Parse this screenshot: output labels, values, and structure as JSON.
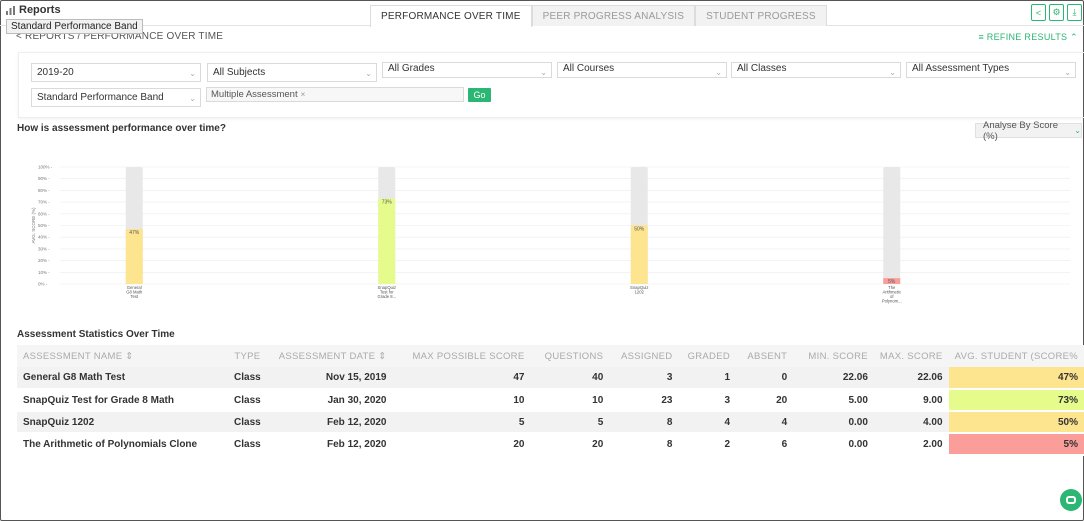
{
  "header": {
    "app_title": "Reports",
    "tooltip": "Standard Performance Band",
    "tabs": [
      "PERFORMANCE OVER TIME",
      "PEER PROGRESS ANALYSIS",
      "STUDENT PROGRESS"
    ],
    "buttons": [
      "share-icon",
      "settings-icon",
      "download-icon"
    ]
  },
  "breadcrumb": "< REPORTS / PERFORMANCE OVER TIME",
  "refine_label": "≡ REFINE RESULTS ⌃",
  "filters": {
    "year": "2019-20",
    "subject": "All Subjects",
    "grades": "All Grades",
    "courses": "All Courses",
    "classes": "All Classes",
    "assessment_types": "All Assessment Types",
    "band": "Standard Performance Band",
    "assessment_tag": "Multiple Assessment",
    "go_label": "Go"
  },
  "chart_question": "How is assessment performance over time?",
  "analyse_by": "Analyse By Score (%)",
  "chart_data": {
    "type": "bar",
    "ylabel": "AVG. SCORE (%)",
    "ylim": [
      0,
      100
    ],
    "yticks": [
      "100% -",
      "90% -",
      "80% -",
      "70% -",
      "60% -",
      "50% -",
      "40% -",
      "30% -",
      "20% -",
      "10% -",
      "0% -"
    ],
    "categories": [
      [
        "General",
        "G8 Math",
        "Test"
      ],
      [
        "SnapQuiz",
        "Test for",
        "Grade 8..."
      ],
      [
        "SnapQuiz",
        "1202"
      ],
      [
        "The",
        "Arithmetic",
        "of",
        "Polynom..."
      ]
    ],
    "values": [
      47,
      73,
      50,
      5
    ],
    "value_labels": [
      "47%",
      "73%",
      "50%",
      "5%"
    ],
    "bar_colors": [
      "#fde48f",
      "#e5fb8b",
      "#fde48f",
      "#fb9e9a"
    ],
    "track_color": "#e8e8e8",
    "grid": true
  },
  "stats": {
    "title": "Assessment Statistics Over Time",
    "columns": [
      "ASSESSMENT NAME ⇕",
      "TYPE",
      "ASSESSMENT DATE ⇕",
      "MAX POSSIBLE SCORE",
      "QUESTIONS",
      "ASSIGNED",
      "GRADED",
      "ABSENT",
      "MIN. SCORE",
      "MAX. SCORE",
      "AVG. STUDENT (SCORE%"
    ],
    "rows": [
      {
        "name": "General G8 Math Test",
        "type": "Class",
        "date": "Nov 15, 2019",
        "max_possible": "47",
        "questions": "40",
        "assigned": "3",
        "graded": "1",
        "absent": "0",
        "min": "22.06",
        "max": "22.06",
        "avg": "47%",
        "avg_color": "#fde48f"
      },
      {
        "name": "SnapQuiz Test for Grade 8 Math",
        "type": "Class",
        "date": "Jan 30, 2020",
        "max_possible": "10",
        "questions": "10",
        "assigned": "23",
        "graded": "3",
        "absent": "20",
        "min": "5.00",
        "max": "9.00",
        "avg": "73%",
        "avg_color": "#e5fb8b"
      },
      {
        "name": "SnapQuiz 1202",
        "type": "Class",
        "date": "Feb 12, 2020",
        "max_possible": "5",
        "questions": "5",
        "assigned": "8",
        "graded": "4",
        "absent": "4",
        "min": "0.00",
        "max": "4.00",
        "avg": "50%",
        "avg_color": "#fde48f"
      },
      {
        "name": "The Arithmetic of Polynomials Clone",
        "type": "Class",
        "date": "Feb 12, 2020",
        "max_possible": "20",
        "questions": "20",
        "assigned": "8",
        "graded": "2",
        "absent": "6",
        "min": "0.00",
        "max": "2.00",
        "avg": "5%",
        "avg_color": "#fb9e9a"
      }
    ]
  }
}
